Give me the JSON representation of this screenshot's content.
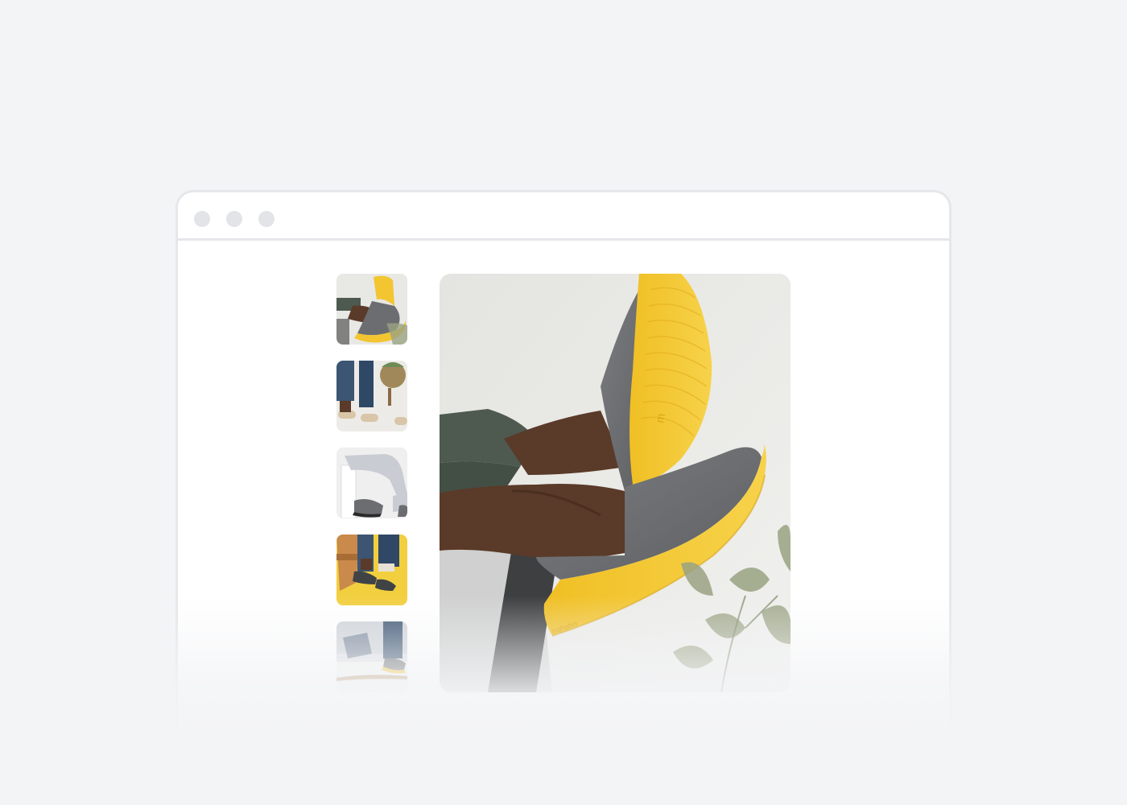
{
  "window": {
    "controls": [
      "close-dot",
      "minimize-dot",
      "maximize-dot"
    ]
  },
  "gallery": {
    "thumbnails": [
      {
        "name": "thumbnail-crossed-legs-yellow-sole",
        "icon": "photo-thumbnail"
      },
      {
        "name": "thumbnail-seated-jeans-beige",
        "icon": "photo-thumbnail"
      },
      {
        "name": "thumbnail-side-view-grey",
        "icon": "photo-thumbnail"
      },
      {
        "name": "thumbnail-chair-yellow-background",
        "icon": "photo-thumbnail"
      },
      {
        "name": "thumbnail-walking-white-rug",
        "icon": "photo-thumbnail"
      }
    ],
    "main_image": {
      "name": "main-product-photo",
      "icon": "photo"
    },
    "colors": {
      "felt": "#6b6d70",
      "sole": "#f3c531",
      "wall": "#e9e9e6",
      "skin": "#5a3a28",
      "pants": "#4e5a4f",
      "plant": "#9aa383"
    }
  }
}
